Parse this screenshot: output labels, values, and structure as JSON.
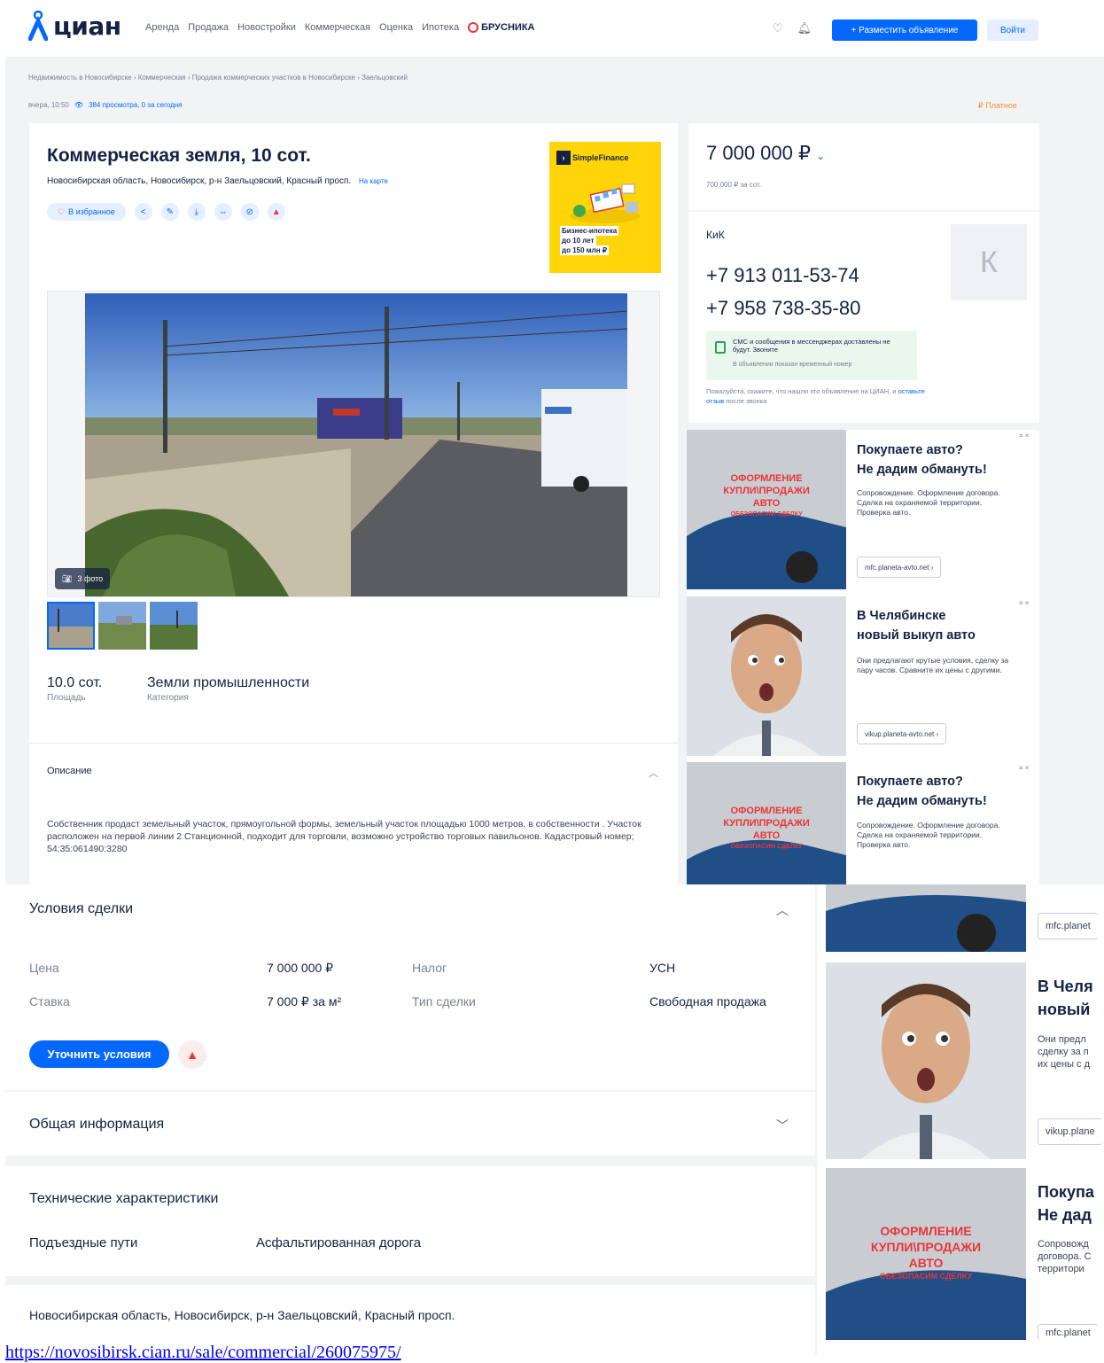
{
  "header": {
    "logo": "циан",
    "nav": [
      "Аренда",
      "Продажа",
      "Новостройки",
      "Коммерческая",
      "Оценка",
      "Ипотека"
    ],
    "brand_link": "БРУСНИКА",
    "post_ad": "+ Разместить объявление",
    "login": "Войти"
  },
  "breadcrumbs": "Недвижимость в Новосибирске › Коммерческая › Продажа коммерческих участков в Новосибирске › Заельцовский",
  "meta": {
    "time": "вчера, 10:50",
    "views": "384 просмотра, 0 за сегодня",
    "paid": "Платное"
  },
  "listing": {
    "title": "Коммерческая земля, 10 сот.",
    "address": "Новосибирская область, Новосибирск, р-н Заельцовский, Красный просп.",
    "map_link": "На карте",
    "favorite": "В избранное",
    "photos_count": "3 фото",
    "facts": [
      {
        "value": "10.0 сот.",
        "label": "Площадь"
      },
      {
        "value": "Земли промышленности",
        "label": "Категория"
      }
    ],
    "description_title": "Описание",
    "description": "Собственник продаст земельный участок, прямоугольной формы, земельный участок площадью 1000 метров, в собственности . Участок расположен на первой линии 2 Станционной, подходит для торговли, возможно устройство торговых павильонов. Кадастровый номер; 54:35:061490:3280"
  },
  "promo": {
    "brand": "SimpleFinance",
    "line1": "Бизнес-ипотека",
    "line2": "до 10 лет",
    "line3": "до 150 млн ₽"
  },
  "price": {
    "value": "7 000 000 ₽",
    "per_unit": "700 000 ₽ за сот."
  },
  "seller": {
    "name": "КиК",
    "avatar_letter": "К",
    "phones": [
      "+7 913 011-53-74",
      "+7 958 738-35-80"
    ],
    "sms_note": "СМС и сообщения в мессенджерах доставлены не будут. Звоните",
    "sms_sub": "В объявлении показан временный номер",
    "tell_prefix": "Пожалуйста, скажите, что нашли это объявление на ЦИАН, и",
    "tell_link": "оставьте отзыв",
    "tell_suffix": "после звонка"
  },
  "ads": [
    {
      "title1": "Покупаете авто?",
      "title2": "Не дадим обмануть!",
      "text": "Сопровождение. Оформление договора. Сделка на охраняемой территории. Проверка авто.",
      "link": "mfc.planeta-avto.net ›",
      "banner": [
        "ОФОРМЛЕНИЕ",
        "КУПЛИ\\ПРОДАЖИ",
        "АВТО",
        "ОБЕЗОПАСИМ СДЕЛКУ"
      ]
    },
    {
      "title1": "В Челябинске",
      "title2": "новый выкуп авто",
      "text": "Они предлагают крутые условия, сделку за пару часов. Сравните их цены с другими.",
      "link": "vikup.planeta-avto.net ›"
    },
    {
      "title1": "Покупаете авто?",
      "title2": "Не дадим обмануть!",
      "text": "Сопровождение. Оформление договора. Сделка на охраняемой территории. Проверка авто."
    }
  ],
  "ads_zoomed": {
    "link1": "mfc.planet",
    "title2a": "В Челя",
    "title2b": "новый",
    "text2": [
      "Они предл",
      "сделку за п",
      "их цены с д"
    ],
    "link2": "vikup.plane",
    "title3a": "Покупа",
    "title3b": "Не дад",
    "text3": [
      "Сопровожд",
      "договора. С",
      "территори"
    ],
    "link3": "mfc.planet"
  },
  "deal": {
    "title": "Условия сделки",
    "rows": [
      {
        "l1": "Цена",
        "v1": "7 000 000 ₽",
        "l2": "Налог",
        "v2": "УСН"
      },
      {
        "l1": "Ставка",
        "v1": "7 000 ₽ за м²",
        "l2": "Тип сделки",
        "v2": "Свободная продажа"
      }
    ],
    "clarify": "Уточнить условия"
  },
  "general": {
    "title": "Общая информация"
  },
  "tech": {
    "title": "Технические характеристики",
    "label": "Подъездные пути",
    "value": "Асфальтированная дорога"
  },
  "bottom_address": "Новосибирская область, Новосибирск, р-н Заельцовский, Красный просп.",
  "url": "https://novosibirsk.cian.ru/sale/commercial/260075975/",
  "colors": {
    "brand_blue": "#0468ff",
    "text_dark": "#152242",
    "muted": "#7a8194",
    "alert_red": "#e8353a",
    "promo_yellow": "#ffd50a"
  }
}
